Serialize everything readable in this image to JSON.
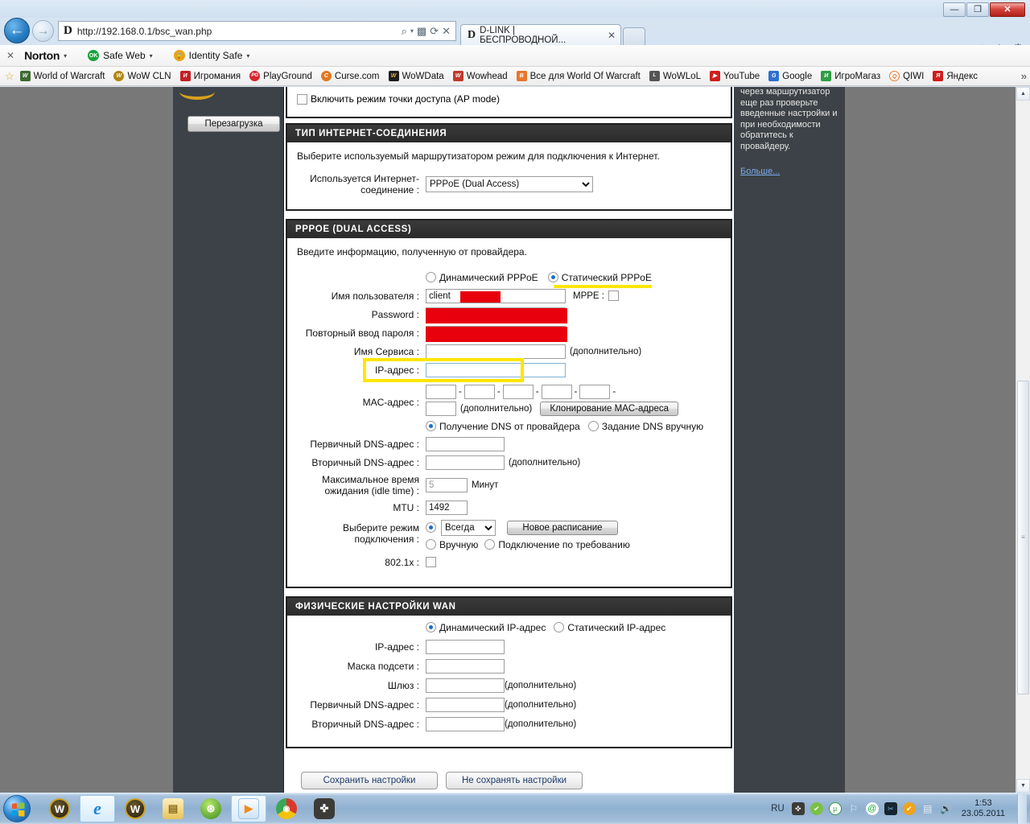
{
  "window": {
    "minimize_label": "—",
    "restore_label": "❐",
    "close_label": "✕"
  },
  "browser": {
    "back_glyph": "←",
    "forward_glyph": "→",
    "address": {
      "favicon_letter": "D",
      "url": "http://192.168.0.1/bsc_wan.php",
      "search_glyph": "⌕",
      "caret_glyph": "▾",
      "compat_glyph": "▩",
      "refresh_glyph": "⟳",
      "stop_glyph": "✕"
    },
    "tabs": [
      {
        "favicon_letter": "D",
        "title": "D-LINK | БЕСПРОВОДНОЙ...",
        "close_glyph": "✕"
      }
    ],
    "nav_right": {
      "home_glyph": "⌂",
      "favorites_glyph": "☆",
      "tools_glyph": "⚙"
    }
  },
  "norton_toolbar": {
    "close_glyph": "✕",
    "brand": "Norton",
    "brand_caret": "▾",
    "items": [
      {
        "label": "Safe Web",
        "badge": "OK",
        "badge_color": "#19a33c",
        "caret": "▾"
      },
      {
        "label": "Identity Safe",
        "badge": "🔒",
        "badge_color": "#e8a317",
        "caret": "▾"
      }
    ]
  },
  "bookmarks": {
    "star_glyph": "☆",
    "overflow_glyph": "»",
    "items": [
      {
        "label": "World of Warcraft",
        "color": "#3c6b30",
        "letter": "W"
      },
      {
        "label": "WoW CLN",
        "color": "#b08615",
        "letter": "W"
      },
      {
        "label": "Игромания",
        "color": "#c32026",
        "letter": "И"
      },
      {
        "label": "PlayGround",
        "color": "#d6262c",
        "letter": "PG"
      },
      {
        "label": "Curse.com",
        "color": "#e07820",
        "letter": "C"
      },
      {
        "label": "WoWData",
        "color": "#1d1d1d",
        "letter": "W"
      },
      {
        "label": "Wowhead",
        "color": "#c0392b",
        "letter": "W"
      },
      {
        "label": "Все для World Of Warcraft",
        "color": "#e8762c",
        "letter": "B"
      },
      {
        "label": "WoWLoL",
        "color": "#555555",
        "letter": "L"
      },
      {
        "label": "YouTube",
        "color": "#d01d1d",
        "letter": "▶"
      },
      {
        "label": "Google",
        "color": "#2f6fd0",
        "letter": "G"
      },
      {
        "label": "ИгроМагаз",
        "color": "#2f9e44",
        "letter": "И"
      },
      {
        "label": "QIWI",
        "color": "#e8762c",
        "letter": "Q"
      },
      {
        "label": "Яндекс",
        "color": "#d01d1d",
        "letter": "Я"
      }
    ]
  },
  "router": {
    "left": {
      "reboot_button": "Перезагрузка"
    },
    "ap_mode": {
      "label": "Включить режим точки доступа (AP mode)",
      "checked": false
    },
    "connection_type": {
      "title": "ТИП ИНТЕРНЕТ-СОЕДИНЕНИЯ",
      "description": "Выберите используемый маршрутизатором режим для подключения к Интернет.",
      "field_label": "Используется Интернет-соединение :",
      "selected_option": "PPPoE (Dual Access)",
      "options": [
        "PPPoE (Dual Access)"
      ]
    },
    "pppoe": {
      "title": "PPPOE (DUAL ACCESS)",
      "description": "Введите информацию, полученную от провайдера.",
      "mode_dynamic": "Динамический PPPoE",
      "mode_static": "Статический PPPoE",
      "mode_selected": "static",
      "username_label": "Имя пользователя :",
      "username_value": "client",
      "mppe_label": "MPPE :",
      "mppe_checked": false,
      "password_label": "Password :",
      "password_value": "",
      "password_confirm_label": "Повторный ввод пароля :",
      "password_confirm_value": "",
      "service_name_label": "Имя Сервиса :",
      "service_name_value": "",
      "service_name_hint": "(дополнительно)",
      "ip_label": "IP-адрес :",
      "ip_value": "",
      "mac_label": "MAC-адрес :",
      "mac_octets": [
        "",
        "",
        "",
        "",
        "",
        ""
      ],
      "mac_separator": "-",
      "mac_hint": "(дополнительно)",
      "mac_clone_button": "Клонирование MAC-адреса",
      "dns_auto": "Получение DNS от провайдера",
      "dns_manual": "Задание DNS вручную",
      "dns_selected": "auto",
      "dns_primary_label": "Первичный DNS-адрес :",
      "dns_primary_value": "",
      "dns_secondary_label": "Вторичный DNS-адрес :",
      "dns_secondary_value": "",
      "dns_secondary_hint": "(дополнительно)",
      "idle_label": "Максимальное время ожидания (idle time) :",
      "idle_value": "5",
      "idle_unit": "Минут",
      "mtu_label": "MTU :",
      "mtu_value": "1492",
      "conn_mode_label": "Выберите режим подключения :",
      "conn_mode_always": "Всегда",
      "conn_mode_schedule_button": "Новое расписание",
      "conn_mode_manual": "Вручную",
      "conn_mode_on_demand": "Подключение по требованию",
      "conn_mode_selected": "always",
      "dot1x_label": "802.1x :",
      "dot1x_checked": false
    },
    "wan_physical": {
      "title": "ФИЗИЧЕСКИЕ НАСТРОЙКИ WAN",
      "mode_dynamic": "Динамический IP-адрес",
      "mode_static": "Статический IP-адрес",
      "mode_selected": "dynamic",
      "ip_label": "IP-адрес :",
      "ip_value": "",
      "mask_label": "Маска подсети :",
      "mask_value": "",
      "gateway_label": "Шлюз :",
      "gateway_value": "",
      "gateway_hint": "(дополнительно)",
      "dns_primary_label": "Первичный DNS-адрес :",
      "dns_primary_value": "",
      "dns_primary_hint": "(дополнительно)",
      "dns_secondary_label": "Вторичный DNS-адрес :",
      "dns_secondary_value": "",
      "dns_secondary_hint": "(дополнительно)"
    },
    "footer_buttons": {
      "save": "Сохранить настройки",
      "discard": "Не сохранять настройки"
    },
    "help": {
      "text": "через маршрутизатор еще раз проверьте введенные настройки и при необходимости обратитесь к провайдеру.",
      "more_link": "Больше..."
    }
  },
  "scrollbar": {
    "up_glyph": "▲",
    "down_glyph": "▼",
    "grip_glyph": "≡"
  },
  "taskbar": {
    "items": [
      {
        "name": "wow-1",
        "letter": "W",
        "color": "#2b2216",
        "active": false
      },
      {
        "name": "internet-explorer",
        "letter": "e",
        "color": "#2f8bd6",
        "active": true
      },
      {
        "name": "wow-2",
        "letter": "W",
        "color": "#2b2216",
        "active": false
      },
      {
        "name": "explorer-folder",
        "letter": "▤",
        "color": "#e8b84b",
        "active": false
      },
      {
        "name": "utorrent-green",
        "letter": "⊛",
        "color": "#6bbf3a",
        "active": false
      },
      {
        "name": "media-player",
        "letter": "▶",
        "color": "#f08a1c",
        "active": true
      },
      {
        "name": "google-chrome",
        "letter": "◉",
        "color": "#d8392b",
        "active": false
      },
      {
        "name": "steam",
        "letter": "✜",
        "color": "#3d3b37",
        "active": false
      }
    ],
    "tray": {
      "language": "RU",
      "icons": [
        {
          "name": "steam-tray",
          "glyph": "✜",
          "color": "#3d3b37"
        },
        {
          "name": "antivirus-tray",
          "glyph": "✔",
          "color": "#7bc043"
        },
        {
          "name": "utorrent-tray",
          "glyph": "µ",
          "color": "#2f9e44"
        },
        {
          "name": "flag-tray",
          "glyph": "⚐",
          "color": "#8fa7bd"
        },
        {
          "name": "opera-tray",
          "glyph": "@",
          "color": "#1faa3f"
        },
        {
          "name": "punto-tray",
          "glyph": "✂",
          "color": "#17252f"
        },
        {
          "name": "sync-tray",
          "glyph": "✔",
          "color": "#f0a21c"
        },
        {
          "name": "network-tray",
          "glyph": "▤",
          "color": "#6b7d8e"
        },
        {
          "name": "volume-tray",
          "glyph": "🔊",
          "color": "#7f8fa0"
        }
      ],
      "time": "1:53",
      "date": "23.05.2011"
    }
  }
}
